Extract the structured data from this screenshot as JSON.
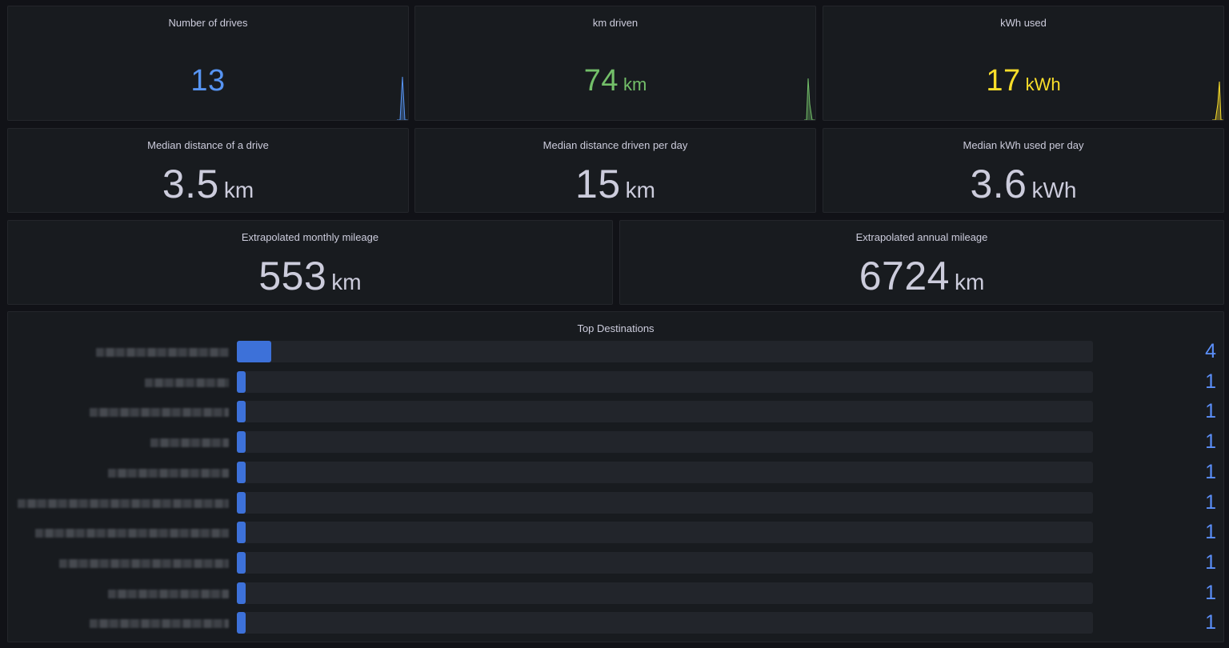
{
  "colors": {
    "blue": "#5794f2",
    "green": "#73bf69",
    "yellow": "#fade2a",
    "neutral": "#ccccdc",
    "bar": "#3d71d9"
  },
  "stats_top": [
    {
      "title": "Number of drives",
      "value": "13",
      "unit": "",
      "color": "blue"
    },
    {
      "title": "km driven",
      "value": "74",
      "unit": "km",
      "color": "green"
    },
    {
      "title": "kWh used",
      "value": "17",
      "unit": "kWh",
      "color": "yellow"
    }
  ],
  "stats_mid": [
    {
      "title": "Median distance of a drive",
      "value": "3.5",
      "unit": "km"
    },
    {
      "title": "Median distance driven per day",
      "value": "15",
      "unit": "km"
    },
    {
      "title": "Median kWh used per day",
      "value": "3.6",
      "unit": "kWh"
    }
  ],
  "stats_wide": [
    {
      "title": "Extrapolated monthly mileage",
      "value": "553",
      "unit": "km"
    },
    {
      "title": "Extrapolated annual mileage",
      "value": "6724",
      "unit": "km"
    }
  ],
  "top_destinations": {
    "title": "Top Destinations",
    "max": 4,
    "rows": [
      {
        "count": "4"
      },
      {
        "count": "1"
      },
      {
        "count": "1"
      },
      {
        "count": "1"
      },
      {
        "count": "1"
      },
      {
        "count": "1"
      },
      {
        "count": "1"
      },
      {
        "count": "1"
      },
      {
        "count": "1"
      },
      {
        "count": "1"
      }
    ]
  }
}
